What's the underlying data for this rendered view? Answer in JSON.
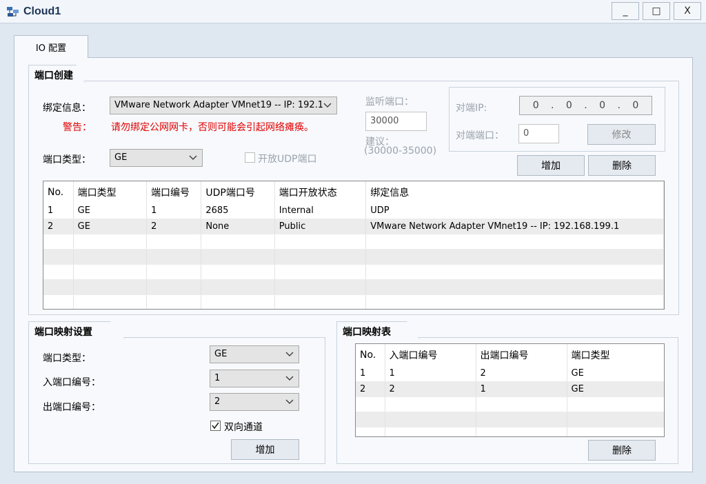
{
  "window": {
    "title": "Cloud1",
    "minimize": "_",
    "maximize": "□",
    "close": "X"
  },
  "tab": {
    "label": "IO 配置"
  },
  "port_create": {
    "title": "端口创建",
    "binding_label": "绑定信息：",
    "binding_value": "VMware Network Adapter VMnet19 -- IP: 192.1",
    "warning_label": "警告：",
    "warning_text": "请勿绑定公网网卡，否则可能会引起网络瘫痪。",
    "port_type_label": "端口类型：",
    "port_type_value": "GE",
    "open_udp_label": "开放UDP端口",
    "listen_port_label": "监听端口：",
    "listen_port_value": "30000",
    "suggest_label": "建议：",
    "suggest_range": "(30000-35000)",
    "peer_ip_label": "对端IP:",
    "peer_ip_octets": [
      "0",
      "0",
      "0",
      "0"
    ],
    "peer_port_label": "对端端口：",
    "peer_port_value": "0",
    "modify_button": "修改",
    "add_button": "增加",
    "delete_button": "删除",
    "table": {
      "headers": [
        "No.",
        "端口类型",
        "端口编号",
        "UDP端口号",
        "端口开放状态",
        "绑定信息"
      ],
      "rows": [
        [
          "1",
          "GE",
          "1",
          "2685",
          "Internal",
          "UDP"
        ],
        [
          "2",
          "GE",
          "2",
          "None",
          "Public",
          "VMware Network Adapter VMnet19 -- IP: 192.168.199.1"
        ]
      ]
    }
  },
  "port_mapping_settings": {
    "title": "端口映射设置",
    "port_type_label": "端口类型：",
    "port_type_value": "GE",
    "in_port_label": "入端口编号：",
    "in_port_value": "1",
    "out_port_label": "出端口编号：",
    "out_port_value": "2",
    "bidirectional_label": "双向通道",
    "bidirectional_checked": true,
    "add_button": "增加"
  },
  "port_mapping_table": {
    "title": "端口映射表",
    "headers": [
      "No.",
      "入端口编号",
      "出端口编号",
      "端口类型"
    ],
    "rows": [
      [
        "1",
        "1",
        "2",
        "GE"
      ],
      [
        "2",
        "2",
        "1",
        "GE"
      ]
    ],
    "delete_button": "删除"
  },
  "colors": {
    "warning": "#e00000",
    "title_text": "#1d3354",
    "background": "#dfe7f0",
    "panel": "#f7f9fc"
  }
}
